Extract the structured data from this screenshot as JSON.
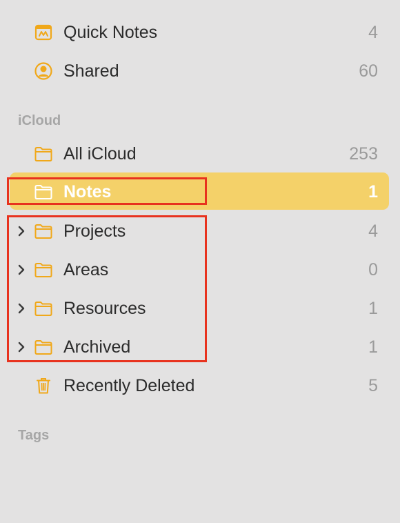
{
  "colors": {
    "background": "#e3e2e2",
    "accent": "#f0a81a",
    "selected_row": "#f4d169",
    "annotation": "#e8321e"
  },
  "top_items": [
    {
      "label": "Quick Notes",
      "count": "4",
      "icon": "quick-notes-icon"
    },
    {
      "label": "Shared",
      "count": "60",
      "icon": "shared-person-icon"
    }
  ],
  "sections": {
    "icloud_header": "iCloud",
    "tags_header": "Tags"
  },
  "icloud_items": [
    {
      "label": "All iCloud",
      "count": "253",
      "icon": "folder-icon",
      "expandable": false,
      "selected": false
    },
    {
      "label": "Notes",
      "count": "1",
      "icon": "folder-icon",
      "expandable": false,
      "selected": true
    },
    {
      "label": "Projects",
      "count": "4",
      "icon": "folder-icon",
      "expandable": true,
      "selected": false
    },
    {
      "label": "Areas",
      "count": "0",
      "icon": "folder-icon",
      "expandable": true,
      "selected": false
    },
    {
      "label": "Resources",
      "count": "1",
      "icon": "folder-icon",
      "expandable": true,
      "selected": false
    },
    {
      "label": "Archived",
      "count": "1",
      "icon": "folder-icon",
      "expandable": true,
      "selected": false
    },
    {
      "label": "Recently Deleted",
      "count": "5",
      "icon": "trash-icon",
      "expandable": false,
      "selected": false
    }
  ]
}
